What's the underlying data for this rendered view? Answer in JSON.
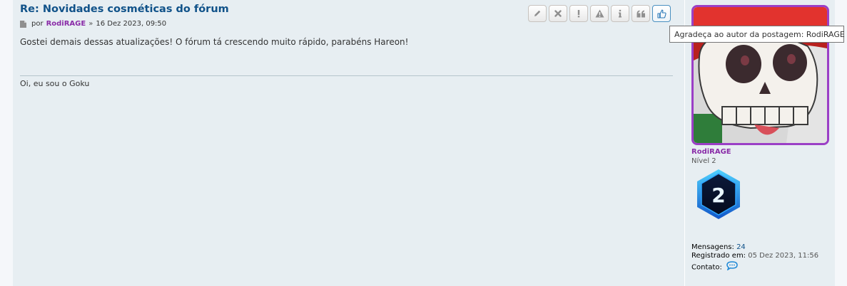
{
  "post": {
    "title": "Re: Novidades cosméticas do fórum",
    "meta_prefix": "por",
    "author": "RodiRAGE",
    "date_separator": "»",
    "date": "16 Dez 2023, 09:50",
    "content": "Gostei demais dessas atualizações! O fórum tá crescendo muito rápido, parabéns Hareon!",
    "signature": "Oi, eu sou o Goku"
  },
  "buttons": [
    {
      "name": "edit-button",
      "icon": "pencil-icon"
    },
    {
      "name": "delete-button",
      "icon": "close-icon"
    },
    {
      "name": "report-button",
      "icon": "exclamation-icon"
    },
    {
      "name": "warn-button",
      "icon": "warning-icon"
    },
    {
      "name": "info-button",
      "icon": "info-icon"
    },
    {
      "name": "quote-button",
      "icon": "quote-icon"
    },
    {
      "name": "thanks-button",
      "icon": "thumbs-up-icon"
    }
  ],
  "tooltip": {
    "text": "Agradeça ao autor da postagem: RodiRAGE"
  },
  "profile": {
    "username": "RodiRAGE",
    "rank": "Nível 2",
    "rank_badge_number": "2",
    "posts_label": "Mensagens:",
    "posts_count": "24",
    "registered_label": "Registrado em:",
    "registered_value": "05 Dez 2023, 11:56",
    "contact_label": "Contato:"
  },
  "colors": {
    "title": "#105289",
    "username": "#8a2ca8",
    "avatar_border": "#9b3fc6",
    "post_background": "#e7eef2",
    "thanks_button_border": "#4a90c0"
  }
}
